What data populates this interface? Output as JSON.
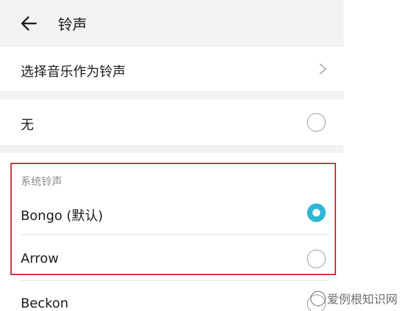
{
  "header": {
    "title": "铃声"
  },
  "music_row": {
    "label": "选择音乐作为铃声"
  },
  "none_row": {
    "label": "无",
    "selected": false
  },
  "system_section": {
    "title": "系统铃声",
    "items": [
      {
        "label": "Bongo (默认)",
        "selected": true
      },
      {
        "label": "Arrow",
        "selected": false
      },
      {
        "label": "Beckon",
        "selected": false
      }
    ]
  },
  "watermark": {
    "text": "爱例根知识网"
  },
  "colors": {
    "accent": "#2fb6d6",
    "highlight_border": "#c8343b",
    "background_gap": "#f2f2f2"
  },
  "icons": {
    "back": "arrow-left-icon",
    "chevron": "chevron-right-icon"
  }
}
